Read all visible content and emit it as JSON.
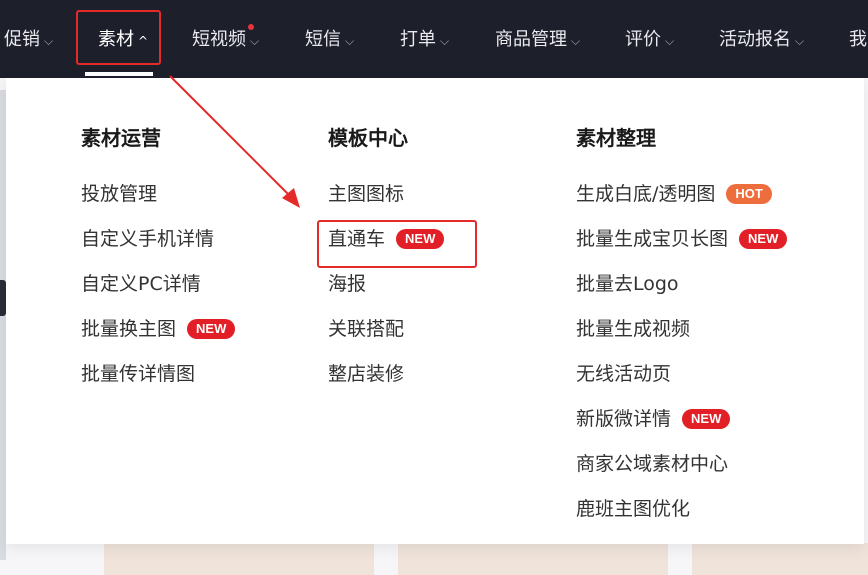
{
  "nav": {
    "items": [
      {
        "label": "促销"
      },
      {
        "label": "素材"
      },
      {
        "label": "短视频"
      },
      {
        "label": "短信"
      },
      {
        "label": "打单"
      },
      {
        "label": "商品管理"
      },
      {
        "label": "评价"
      },
      {
        "label": "活动报名"
      },
      {
        "label": "我"
      }
    ]
  },
  "menu": {
    "columns": [
      {
        "title": "素材运营",
        "items": [
          {
            "label": "投放管理",
            "badge": ""
          },
          {
            "label": "自定义手机详情",
            "badge": ""
          },
          {
            "label": "自定义PC详情",
            "badge": ""
          },
          {
            "label": "批量换主图",
            "badge": "NEW"
          },
          {
            "label": "批量传详情图",
            "badge": ""
          }
        ]
      },
      {
        "title": "模板中心",
        "items": [
          {
            "label": "主图图标",
            "badge": ""
          },
          {
            "label": "直通车",
            "badge": "NEW"
          },
          {
            "label": "海报",
            "badge": ""
          },
          {
            "label": "关联搭配",
            "badge": ""
          },
          {
            "label": "整店装修",
            "badge": ""
          }
        ]
      },
      {
        "title": "素材整理",
        "items": [
          {
            "label": "生成白底/透明图",
            "badge": "HOT"
          },
          {
            "label": "批量生成宝贝长图",
            "badge": "NEW"
          },
          {
            "label": "批量去Logo",
            "badge": ""
          },
          {
            "label": "批量生成视频",
            "badge": ""
          },
          {
            "label": "无线活动页",
            "badge": ""
          },
          {
            "label": "新版微详情",
            "badge": "NEW"
          },
          {
            "label": "商家公域素材中心",
            "badge": ""
          },
          {
            "label": "鹿班主图优化",
            "badge": ""
          }
        ]
      }
    ]
  },
  "colors": {
    "nav_bg": "#1d1f2b",
    "highlight_red": "#e52a2a",
    "badge_new": "#e21f26",
    "badge_hot": "#ee6d3c"
  }
}
